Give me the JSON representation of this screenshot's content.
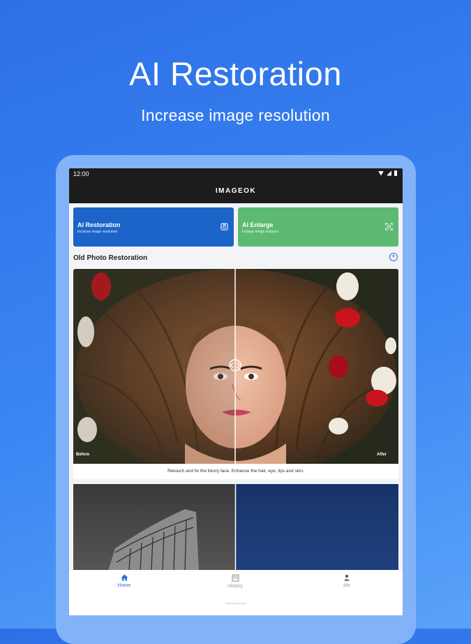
{
  "hero": {
    "title": "AI Restoration",
    "subtitle": "Increase image resolution"
  },
  "status_bar": {
    "time": "12:00"
  },
  "app": {
    "title": "IMAGEOK"
  },
  "cards": [
    {
      "title": "AI Restoration",
      "subtitle": "Increase image resolution",
      "icon": "restore-icon",
      "color": "#1c64c8"
    },
    {
      "title": "AI Enlarge",
      "subtitle": "Enlarge image instance",
      "icon": "enlarge-icon",
      "color": "#5cba72"
    }
  ],
  "section": {
    "title": "Old Photo Restoration",
    "action_icon": "add-circle-icon"
  },
  "comparison": {
    "before_label": "Before",
    "after_label": "After",
    "caption": "Retouch and fix the blurry face. Enhance the hair, eye, lips and skin."
  },
  "tabs": [
    {
      "label": "Home",
      "icon": "home-icon",
      "active": true
    },
    {
      "label": "History",
      "icon": "history-icon",
      "active": false
    },
    {
      "label": "Me",
      "icon": "person-icon",
      "active": false
    }
  ],
  "colors": {
    "accent": "#2a6fe0",
    "app_bar": "#1c1c1c",
    "background": "#3a86f3"
  }
}
